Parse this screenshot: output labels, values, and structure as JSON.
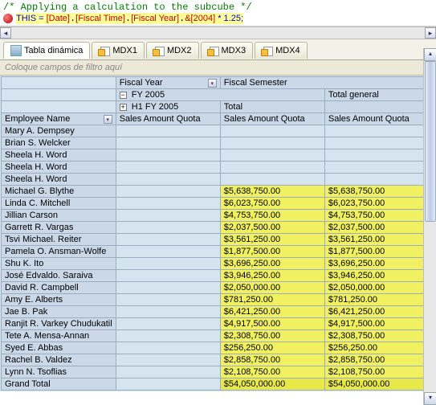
{
  "code": {
    "comment": "/* Applying a calculation to the subcube */",
    "line2_prefix": "THIS = ",
    "line2_dim1": "[Date]",
    "line2_dim2": "[Fiscal Time]",
    "line2_dim3": "[Fiscal Year]",
    "line2_member": "&[2004]",
    "line2_suffix": " * 1.25;"
  },
  "tabs": {
    "pivot": "Tabla dinámica",
    "mdx1": "MDX1",
    "mdx2": "MDX2",
    "mdx3": "MDX3",
    "mdx4": "MDX4"
  },
  "filter_placeholder": "Coloque campos de filtro aquí",
  "pivot": {
    "col_headers": {
      "fiscal_year": "Fiscal Year",
      "fiscal_semester": "Fiscal Semester",
      "fy2005": "FY 2005",
      "h1fy2005": "H1 FY 2005",
      "total": "Total",
      "total_general": "Total general",
      "measure": "Sales Amount Quota"
    },
    "row_header": "Employee Name",
    "rows": [
      {
        "name": "Mary A. Dempsey",
        "v1": "",
        "v2": "",
        "v3": ""
      },
      {
        "name": "Brian S. Welcker",
        "v1": "",
        "v2": "",
        "v3": ""
      },
      {
        "name": "Sheela H. Word",
        "v1": "",
        "v2": "",
        "v3": ""
      },
      {
        "name": "Sheela H. Word",
        "v1": "",
        "v2": "",
        "v3": ""
      },
      {
        "name": "Sheela H. Word",
        "v1": "",
        "v2": "",
        "v3": ""
      },
      {
        "name": "Michael G. Blythe",
        "v1": "",
        "v2": "$5,638,750.00",
        "v3": "$5,638,750.00"
      },
      {
        "name": "Linda C. Mitchell",
        "v1": "",
        "v2": "$6,023,750.00",
        "v3": "$6,023,750.00"
      },
      {
        "name": "Jillian Carson",
        "v1": "",
        "v2": "$4,753,750.00",
        "v3": "$4,753,750.00"
      },
      {
        "name": "Garrett R. Vargas",
        "v1": "",
        "v2": "$2,037,500.00",
        "v3": "$2,037,500.00"
      },
      {
        "name": "Tsvi Michael. Reiter",
        "v1": "",
        "v2": "$3,561,250.00",
        "v3": "$3,561,250.00"
      },
      {
        "name": "Pamela O. Ansman-Wolfe",
        "v1": "",
        "v2": "$1,877,500.00",
        "v3": "$1,877,500.00"
      },
      {
        "name": "Shu K. Ito",
        "v1": "",
        "v2": "$3,696,250.00",
        "v3": "$3,696,250.00"
      },
      {
        "name": "José Edvaldo. Saraiva",
        "v1": "",
        "v2": "$3,946,250.00",
        "v3": "$3,946,250.00"
      },
      {
        "name": "David R. Campbell",
        "v1": "",
        "v2": "$2,050,000.00",
        "v3": "$2,050,000.00"
      },
      {
        "name": "Amy E. Alberts",
        "v1": "",
        "v2": "$781,250.00",
        "v3": "$781,250.00"
      },
      {
        "name": "Jae B. Pak",
        "v1": "",
        "v2": "$6,421,250.00",
        "v3": "$6,421,250.00"
      },
      {
        "name": "Ranjit R. Varkey Chudukatil",
        "v1": "",
        "v2": "$4,917,500.00",
        "v3": "$4,917,500.00"
      },
      {
        "name": "Tete A. Mensa-Annan",
        "v1": "",
        "v2": "$2,308,750.00",
        "v3": "$2,308,750.00"
      },
      {
        "name": "Syed E. Abbas",
        "v1": "",
        "v2": "$256,250.00",
        "v3": "$256,250.00"
      },
      {
        "name": "Rachel B. Valdez",
        "v1": "",
        "v2": "$2,858,750.00",
        "v3": "$2,858,750.00"
      },
      {
        "name": "Lynn N. Tsoflias",
        "v1": "",
        "v2": "$2,108,750.00",
        "v3": "$2,108,750.00"
      }
    ],
    "grand_total": {
      "name": "Grand Total",
      "v1": "",
      "v2": "$54,050,000.00",
      "v3": "$54,050,000.00"
    }
  }
}
